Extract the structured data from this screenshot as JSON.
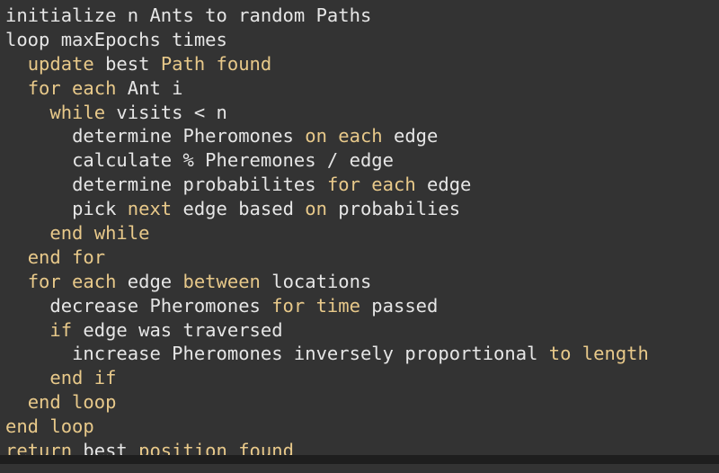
{
  "colors": {
    "background": "#333333",
    "text": "#e6e6e6",
    "keyword": "#e8c98a",
    "bottom_bar": "#1e1e1e"
  },
  "code_lines": [
    {
      "indent": 0,
      "tokens": [
        {
          "t": "initialize n Ants to random Paths",
          "k": "plain"
        }
      ]
    },
    {
      "indent": 0,
      "tokens": [
        {
          "t": "loop maxEpochs times",
          "k": "plain"
        }
      ]
    },
    {
      "indent": 2,
      "tokens": [
        {
          "t": "update",
          "k": "kw"
        },
        {
          "t": " best ",
          "k": "plain"
        },
        {
          "t": "Path found",
          "k": "kw"
        }
      ]
    },
    {
      "indent": 2,
      "tokens": [
        {
          "t": "for each",
          "k": "kw"
        },
        {
          "t": " Ant i",
          "k": "plain"
        }
      ]
    },
    {
      "indent": 4,
      "tokens": [
        {
          "t": "while",
          "k": "kw"
        },
        {
          "t": " visits < n",
          "k": "plain"
        }
      ]
    },
    {
      "indent": 6,
      "tokens": [
        {
          "t": "determine Pheromones ",
          "k": "plain"
        },
        {
          "t": "on each",
          "k": "kw"
        },
        {
          "t": " edge",
          "k": "plain"
        }
      ]
    },
    {
      "indent": 6,
      "tokens": [
        {
          "t": "calculate % Pheremones / edge",
          "k": "plain"
        }
      ]
    },
    {
      "indent": 6,
      "tokens": [
        {
          "t": "determine probabilites ",
          "k": "plain"
        },
        {
          "t": "for each",
          "k": "kw"
        },
        {
          "t": " edge",
          "k": "plain"
        }
      ]
    },
    {
      "indent": 6,
      "tokens": [
        {
          "t": "pick ",
          "k": "plain"
        },
        {
          "t": "next",
          "k": "kw"
        },
        {
          "t": " edge based ",
          "k": "plain"
        },
        {
          "t": "on",
          "k": "kw"
        },
        {
          "t": " probabilies",
          "k": "plain"
        }
      ]
    },
    {
      "indent": 4,
      "tokens": [
        {
          "t": "end while",
          "k": "kw"
        }
      ]
    },
    {
      "indent": 2,
      "tokens": [
        {
          "t": "end for",
          "k": "kw"
        }
      ]
    },
    {
      "indent": 2,
      "tokens": [
        {
          "t": "for each",
          "k": "kw"
        },
        {
          "t": " edge ",
          "k": "plain"
        },
        {
          "t": "between",
          "k": "kw"
        },
        {
          "t": " locations",
          "k": "plain"
        }
      ]
    },
    {
      "indent": 4,
      "tokens": [
        {
          "t": "decrease Pheromones ",
          "k": "plain"
        },
        {
          "t": "for time",
          "k": "kw"
        },
        {
          "t": " passed",
          "k": "plain"
        }
      ]
    },
    {
      "indent": 4,
      "tokens": [
        {
          "t": "if",
          "k": "kw"
        },
        {
          "t": " edge was traversed",
          "k": "plain"
        }
      ]
    },
    {
      "indent": 6,
      "tokens": [
        {
          "t": "increase Pheromones inversely proportional ",
          "k": "plain"
        },
        {
          "t": "to length",
          "k": "kw"
        }
      ]
    },
    {
      "indent": 4,
      "tokens": [
        {
          "t": "end if",
          "k": "kw"
        }
      ]
    },
    {
      "indent": 2,
      "tokens": [
        {
          "t": "end loop",
          "k": "kw"
        }
      ]
    },
    {
      "indent": 0,
      "tokens": [
        {
          "t": "end loop",
          "k": "kw"
        }
      ]
    },
    {
      "indent": 0,
      "tokens": [
        {
          "t": "return",
          "k": "kw"
        },
        {
          "t": " best ",
          "k": "plain"
        },
        {
          "t": "position found",
          "k": "kw"
        }
      ]
    }
  ]
}
